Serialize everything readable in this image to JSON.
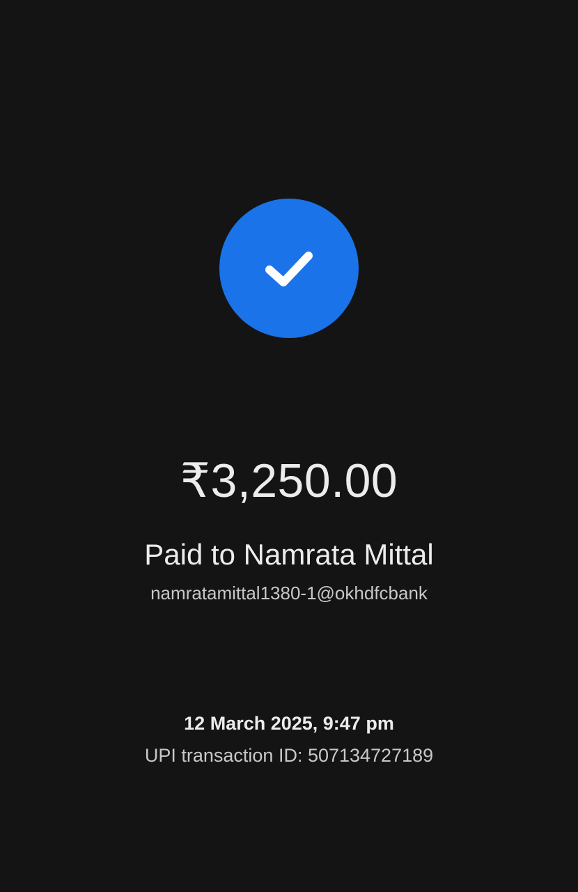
{
  "status": {
    "icon": "checkmark-icon",
    "accent_color": "#1a73e8"
  },
  "payment": {
    "amount": "₹3,250.00",
    "paid_to": "Paid to Namrata Mittal",
    "upi_id": "namratamittal1380-1@okhdfcbank"
  },
  "details": {
    "datetime": "12 March 2025, 9:47 pm",
    "transaction_id": "UPI transaction ID: 507134727189"
  }
}
